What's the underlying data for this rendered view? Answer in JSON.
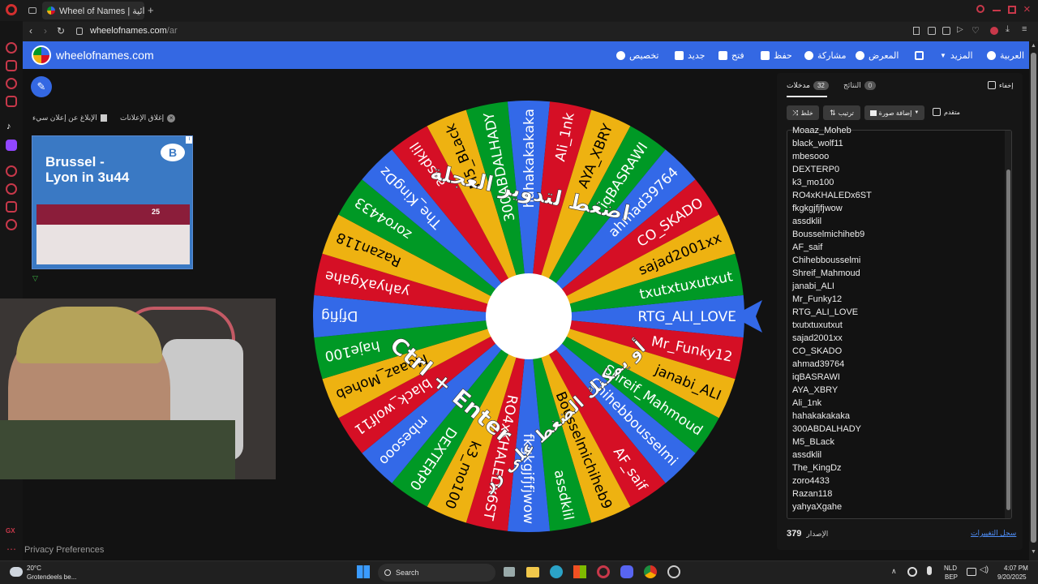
{
  "browser": {
    "tab_title": "Wheel of Names | عجلة عشوائية",
    "url_host": "wheelofnames.com",
    "url_path": "/ar"
  },
  "header": {
    "brand": "wheelofnames.com",
    "nav": {
      "customize": "تخصيص",
      "new": "جديد",
      "open": "فتح",
      "save": "حفظ",
      "share": "مشاركة",
      "gallery": "المعرض",
      "more": "المزيد",
      "language": "العربية"
    }
  },
  "ads": {
    "close_ads": "إغلاق الإعلانات",
    "report_ad": "الإبلاغ عن إعلان سيء",
    "ad_line1": "Brussel -",
    "ad_line2": "Lyon in 3u44",
    "ad_badge": "25"
  },
  "wheel": {
    "center_color": "#ffffff",
    "colors": [
      "#3369e8",
      "#d50f25",
      "#eeb211",
      "#009925"
    ],
    "overlay_line1": "اضغط لتدوير العجلة",
    "overlay_line2": "أو يمكنك الضغط على زر",
    "overlay_line3": "Ctrl + Enter",
    "segments": [
      "RTG_ALI_LOVE",
      "Mr_Funky12",
      "janabi_ALI",
      "Shreif_Mahmoud",
      "Chihebbousselmi",
      "AF_saif",
      "Bousselmichiheb9",
      "assdklil",
      "fkgkgjfjfjwow",
      "RO4xKHALEDx6ST",
      "k3_mo100",
      "DEXTERP0",
      "mbesooo",
      "black_wolf11",
      "Moaaz_Moheb",
      "haje100",
      "Dfjfig",
      "yahyaXgahe",
      "Razan118",
      "zoro4433",
      "The_KingDz",
      "assdklil",
      "M5_BLack",
      "300ABDALHADY",
      "hahakakakaka",
      "Ali_1nk",
      "AYA_XBRY",
      "iqBASRAWI",
      "ahmad39764",
      "CO_SKADO",
      "sajad2001xx",
      "txutxtuxutxut"
    ]
  },
  "panel": {
    "hide_label": "إخفاء",
    "tab_entries": "مدخلات",
    "entries_count": "32",
    "tab_results": "النتائج",
    "results_count": "0",
    "shuffle": "خلط",
    "sort": "ترتيب",
    "add_image": "إضافة صورة",
    "advanced": "متقدم",
    "entries": [
      "Moaaz_Moheb",
      "black_wolf11",
      "mbesooo",
      "DEXTERP0",
      "k3_mo100",
      "RO4xKHALEDx6ST",
      "fkgkgjfjfjwow",
      "assdklil",
      "Bousselmichiheb9",
      "AF_saif",
      "Chihebbousselmi",
      "Shreif_Mahmoud",
      "janabi_ALI",
      "Mr_Funky12",
      "RTG_ALI_LOVE",
      "txutxtuxutxut",
      "sajad2001xx",
      "CO_SKADO",
      "ahmad39764",
      "iqBASRAWI",
      "AYA_XBRY",
      "Ali_1nk",
      "hahakakakaka",
      "300ABDALHADY",
      "M5_BLack",
      "assdklil",
      "The_KingDz",
      "zoro4433",
      "Razan118",
      "yahyaXgahe"
    ],
    "version": "379",
    "version_label": "الإصدار",
    "changelog": "سجل التغييرات"
  },
  "footer": {
    "privacy": "Privacy Preferences"
  },
  "taskbar": {
    "weather_temp": "20°C",
    "weather_desc": "Grotendeels be...",
    "search": "Search",
    "lang1": "NLD",
    "lang2": "BEP",
    "time": "4:07 PM",
    "date": "9/20/2025"
  }
}
